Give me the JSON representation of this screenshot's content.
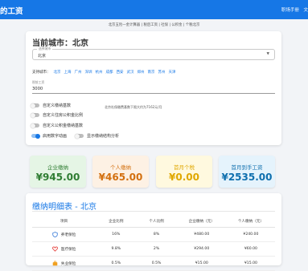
{
  "app": {
    "title": "的工资",
    "guide_label": "职场手册",
    "lang_label": "文"
  },
  "notice": "北京五险一金计算器 | 税后工资 | 社保 | 公积金 | 个税北京",
  "settings": {
    "city_heading": "当前城市：北京",
    "city_select": {
      "label": "选择城市",
      "value": "北京"
    },
    "supported_label": "支持城市：",
    "supported_cities": [
      "北京",
      "上海",
      "广州",
      "深圳",
      "杭州",
      "成都",
      "西安",
      "武汉",
      "郑州",
      "南京",
      "苏州",
      "天津"
    ],
    "salary": {
      "label": "税前工资",
      "value": "3000"
    },
    "toggles": [
      {
        "label": "自定义缴纳基数",
        "on": false
      },
      {
        "label": "自定义住房公积金比例",
        "on": false
      },
      {
        "label": "自定义公积金缴纳基数",
        "on": false
      },
      {
        "label": "启用数字动画",
        "on": true
      },
      {
        "label": "显示缴纳结构分析",
        "on": false
      }
    ],
    "base_hint": "北京社保缴费基数下限大约为7162元/月"
  },
  "summary": {
    "company": {
      "label": "企业缴纳",
      "amount": "¥945.00",
      "color": "#2f7d32"
    },
    "personal": {
      "label": "个人缴纳",
      "amount": "¥465.00",
      "color": "#d3700f"
    },
    "tax": {
      "label": "首月个税",
      "amount": "¥0.00",
      "color": "#e0a800"
    },
    "net": {
      "label": "首月到手工资",
      "amount": "¥2535.00",
      "color": "#0f6fae"
    }
  },
  "detail": {
    "title": "缴纳明细表 - 北京",
    "headers": [
      "项目",
      "企业比例",
      "个人比例",
      "企业缴纳（元）",
      "个人缴纳（元）"
    ],
    "rows": [
      {
        "icon": "shield-icon",
        "icon_color": "#3f7fd9",
        "name": "养老保险",
        "company_rate": "16%",
        "personal_rate": "8%",
        "company_amount": "¥480.00",
        "personal_amount": "¥240.00"
      },
      {
        "icon": "heart-icon",
        "icon_color": "#e53935",
        "name": "医疗保险",
        "company_rate": "9.8%",
        "personal_rate": "2%",
        "company_amount": "¥294.00",
        "personal_amount": "¥60.00"
      },
      {
        "icon": "briefcase-icon",
        "icon_color": "#f0a020",
        "name": "失业保险",
        "company_rate": "0.5%",
        "personal_rate": "0.5%",
        "company_amount": "¥15.00",
        "personal_amount": "¥15.00"
      }
    ]
  }
}
